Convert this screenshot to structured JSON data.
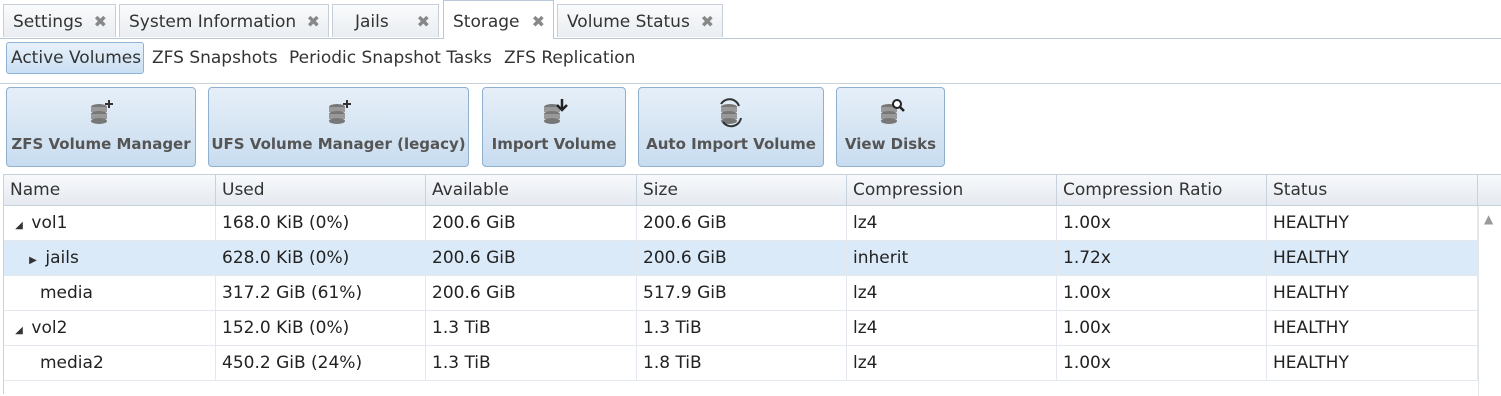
{
  "tabs": [
    {
      "label": "Settings",
      "close": "✖"
    },
    {
      "label": "System Information",
      "close": "✖"
    },
    {
      "label": "Jails",
      "close": "✖"
    },
    {
      "label": "Storage",
      "close": "✖"
    },
    {
      "label": "Volume Status",
      "close": "✖"
    }
  ],
  "active_tab": "Storage",
  "subtabs": [
    "Active Volumes",
    "ZFS Snapshots",
    "Periodic Snapshot Tasks",
    "ZFS Replication"
  ],
  "active_subtab": "Active Volumes",
  "toolbar": [
    {
      "label": "ZFS Volume Manager",
      "icon": "disk-add-icon"
    },
    {
      "label": "UFS Volume Manager (legacy)",
      "icon": "disk-add-icon"
    },
    {
      "label": "Import Volume",
      "icon": "disk-import-icon"
    },
    {
      "label": "Auto Import Volume",
      "icon": "disk-refresh-icon"
    },
    {
      "label": "View Disks",
      "icon": "disk-search-icon"
    }
  ],
  "columns": [
    "Name",
    "Used",
    "Available",
    "Size",
    "Compression",
    "Compression Ratio",
    "Status"
  ],
  "rows": [
    {
      "name": "vol1",
      "used": "168.0 KiB (0%)",
      "available": "200.6 GiB",
      "size": "200.6 GiB",
      "compression": "lz4",
      "ratio": "1.00x",
      "status": "HEALTHY"
    },
    {
      "name": "jails",
      "used": "628.0 KiB (0%)",
      "available": "200.6 GiB",
      "size": "200.6 GiB",
      "compression": "inherit",
      "ratio": "1.72x",
      "status": "HEALTHY"
    },
    {
      "name": "media",
      "used": "317.2 GiB (61%)",
      "available": "200.6 GiB",
      "size": "517.9 GiB",
      "compression": "lz4",
      "ratio": "1.00x",
      "status": "HEALTHY"
    },
    {
      "name": "vol2",
      "used": "152.0 KiB (0%)",
      "available": "1.3 TiB",
      "size": "1.3 TiB",
      "compression": "lz4",
      "ratio": "1.00x",
      "status": "HEALTHY"
    },
    {
      "name": "media2",
      "used": "450.2 GiB (24%)",
      "available": "1.3 TiB",
      "size": "1.8 TiB",
      "compression": "lz4",
      "ratio": "1.00x",
      "status": "HEALTHY"
    }
  ],
  "colors": {
    "accent": "#c9dff3",
    "selected_row": "#dbeaf8"
  }
}
